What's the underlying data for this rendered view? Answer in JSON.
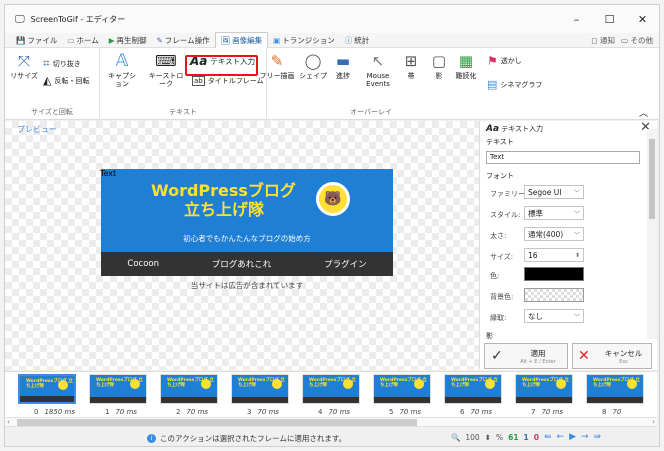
{
  "window": {
    "title": "ScreenToGif - エディター",
    "icon": "monitor-icon",
    "min": "–",
    "max": "☐",
    "close": "✕"
  },
  "tabs": [
    {
      "label": "ファイル",
      "icon": "save-icon"
    },
    {
      "label": "ホーム",
      "icon": "home-icon"
    },
    {
      "label": "再生制御",
      "icon": "play-icon"
    },
    {
      "label": "フレーム操作",
      "icon": "pencil-icon"
    },
    {
      "label": "画像編集",
      "icon": "image-icon",
      "active": true
    },
    {
      "label": "トランジション",
      "icon": "transition-icon"
    },
    {
      "label": "統計",
      "icon": "info-icon"
    }
  ],
  "tabs_right": {
    "notify": "通知",
    "other": "その他"
  },
  "ribbon": {
    "groups": {
      "size": "サイズと回転",
      "text": "テキスト",
      "overlay": "オーバーレイ"
    },
    "resize": "リサイズ",
    "crop": "切り抜き",
    "flip_rotate": "反転・回転",
    "caption": "キャプション",
    "keystrokes": "キーストローク",
    "text_input": "テキスト入力",
    "title_frame": "タイトルフレーム",
    "free_draw": "フリー描画",
    "shape": "シェイプ",
    "progress": "進捗",
    "mouse_events": "Mouse Events",
    "band": "帯",
    "shadow": "影",
    "obfuscate": "難読化",
    "watermark": "透かし",
    "cinemagraph": "シネマグラフ"
  },
  "preview": {
    "label": "プレビュー",
    "overlay_text": "Text",
    "banner_title1": "WordPressブログ",
    "banner_title2": "立ち上げ隊",
    "banner_subtitle": "初心者でもかんたんなブログの始め方",
    "banner_nav": [
      "Cocoon",
      "ブログあれこれ",
      "プラグイン"
    ],
    "ad_notice": "当サイトは広告が含まれています"
  },
  "panel": {
    "title": "テキスト入力",
    "text_section": "テキスト",
    "text_value": "Text",
    "font_section": "フォント",
    "family_label": "ファミリー:",
    "family_value": "Segoe UI",
    "style_label": "スタイル:",
    "style_value": "標準",
    "weight_label": "太さ:",
    "weight_value": "通常(400)",
    "size_label": "サイズ:",
    "size_value": "16",
    "color_label": "色:",
    "color_value": "#000000",
    "bg_label": "背景色:",
    "outline_label": "縁取:",
    "outline_value": "なし",
    "shadow_section": "影",
    "apply_label": "適用",
    "apply_shortcut": "Alt + E / Enter",
    "cancel_label": "キャンセル",
    "cancel_shortcut": "Esc"
  },
  "frames": [
    {
      "index": "0",
      "time": "1850 ms"
    },
    {
      "index": "1",
      "time": "70 ms"
    },
    {
      "index": "2",
      "time": "70 ms"
    },
    {
      "index": "3",
      "time": "70 ms"
    },
    {
      "index": "4",
      "time": "70 ms"
    },
    {
      "index": "5",
      "time": "70 ms"
    },
    {
      "index": "6",
      "time": "70 ms"
    },
    {
      "index": "7",
      "time": "70 ms"
    },
    {
      "index": "8",
      "time": "70"
    }
  ],
  "frame_thumb_title": "WordPressブログ 立ち上げ隊",
  "status": {
    "message": "このアクションは選択されたフレームに適用されます。",
    "zoom": "100",
    "zoom_unit": "%",
    "frame_count": "61",
    "selected": "1",
    "current": "0"
  }
}
